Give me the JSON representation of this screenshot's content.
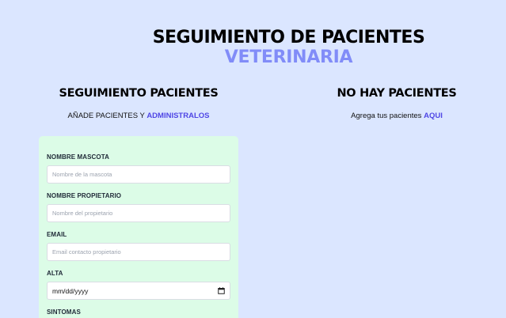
{
  "header": {
    "title": "SEGUIMIENTO DE PACIENTES",
    "subtitle": "VETERINARIA"
  },
  "left_section": {
    "title": "SEGUIMIENTO PACIENTES",
    "subtitle_prefix": "AÑADE PACIENTES Y ",
    "subtitle_accent": "ADMINISTRALOS"
  },
  "right_section": {
    "title": "NO HAY PACIENTES",
    "subtitle_prefix": "Agrega tus pacientes ",
    "subtitle_accent": "AQUI"
  },
  "form": {
    "pet_name": {
      "label": "NOMBRE MASCOTA",
      "placeholder": "Nombre de la mascota",
      "value": ""
    },
    "owner_name": {
      "label": "NOMBRE PROPIETARIO",
      "placeholder": "Nombre del propietario",
      "value": ""
    },
    "email": {
      "label": "EMAIL",
      "placeholder": "Email contacto propietario",
      "value": ""
    },
    "discharge": {
      "label": "ALTA",
      "value": "mm/dd/yyyy",
      "icon": "calendar-icon"
    },
    "symptoms": {
      "label": "SINTOMAS"
    }
  },
  "colors": {
    "background": "#dbe6ff",
    "accent": "#818cf8",
    "link": "#4f46e5",
    "form_bg": "#dcfce7"
  }
}
